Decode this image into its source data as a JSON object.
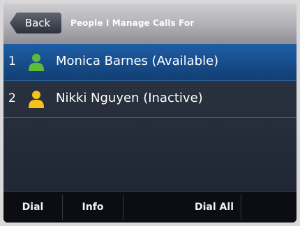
{
  "header": {
    "back_label": "Back",
    "title": "People I Manage Calls For"
  },
  "contacts": [
    {
      "index": "1",
      "name": "Monica Barnes (Available)",
      "status": "available",
      "icon": "person-icon",
      "icon_color": "#5dbb3a",
      "selected": true
    },
    {
      "index": "2",
      "name": "Nikki Nguyen (Inactive)",
      "status": "inactive",
      "icon": "person-icon",
      "icon_color": "#f4c21a",
      "selected": false
    }
  ],
  "softkeys": {
    "dial": "Dial",
    "info": "Info",
    "dial_all": "Dial All"
  },
  "colors": {
    "selected_row": "#1e5ea5",
    "available": "#5dbb3a",
    "inactive": "#f4c21a"
  }
}
